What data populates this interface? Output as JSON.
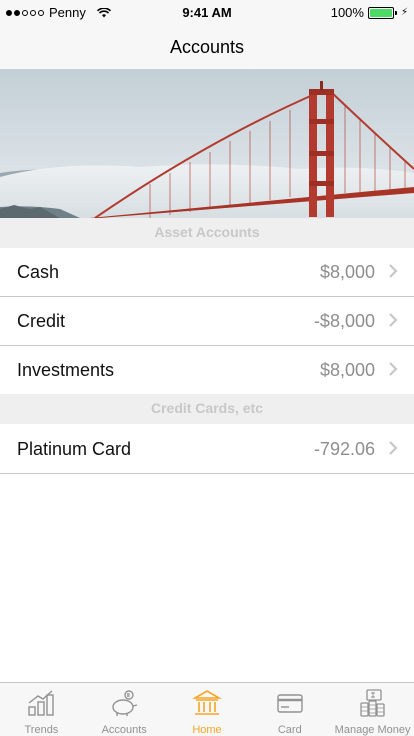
{
  "status_bar": {
    "carrier": "Penny",
    "time": "9:41 AM",
    "battery": "100%"
  },
  "nav": {
    "title": "Accounts"
  },
  "sections": [
    {
      "title": "Asset Accounts",
      "rows": [
        {
          "label": "Cash",
          "value": "$8,000"
        },
        {
          "label": "Credit",
          "value": "-$8,000"
        },
        {
          "label": "Investments",
          "value": "$8,000"
        }
      ]
    },
    {
      "title": "Credit Cards, etc",
      "rows": [
        {
          "label": "Platinum Card",
          "value": "-792.06"
        }
      ]
    }
  ],
  "tabs": [
    {
      "label": "Trends",
      "icon": "chart-icon"
    },
    {
      "label": "Accounts",
      "icon": "piggy-bank-icon"
    },
    {
      "label": "Home",
      "icon": "bank-icon"
    },
    {
      "label": "Card",
      "icon": "credit-card-icon"
    },
    {
      "label": "Manage Money",
      "icon": "money-stack-icon"
    }
  ],
  "colors": {
    "accent": "#f5a623",
    "inactive": "#929292",
    "battery": "#4cd964",
    "bridge": "#b33a2e"
  }
}
